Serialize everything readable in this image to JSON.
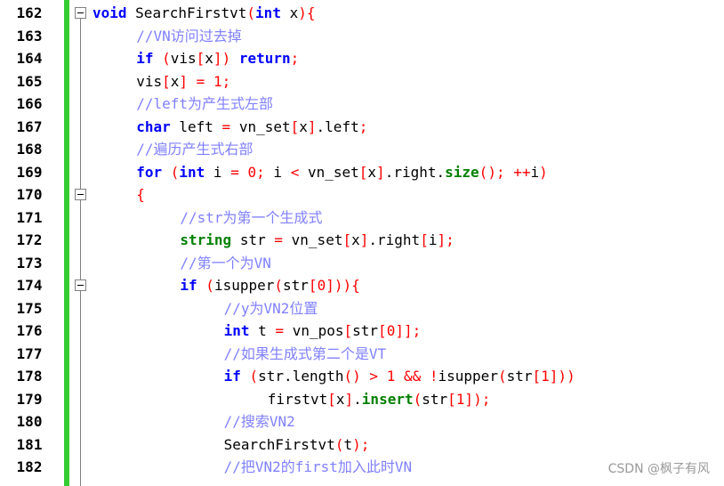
{
  "editor": {
    "lines": [
      {
        "num": "162",
        "text": "void SearchFirstvt(int x){"
      },
      {
        "num": "163",
        "text": "//VN访问过去掉"
      },
      {
        "num": "164",
        "text": "if (vis[x]) return;"
      },
      {
        "num": "165",
        "text": "vis[x] = 1;"
      },
      {
        "num": "166",
        "text": "//left为产生式左部"
      },
      {
        "num": "167",
        "text": "char left = vn_set[x].left;"
      },
      {
        "num": "168",
        "text": "//遍历产生式右部"
      },
      {
        "num": "169",
        "text": "for (int i = 0; i < vn_set[x].right.size(); ++i)"
      },
      {
        "num": "170",
        "text": "{"
      },
      {
        "num": "171",
        "text": "//str为第一个生成式"
      },
      {
        "num": "172",
        "text": "string str = vn_set[x].right[i];"
      },
      {
        "num": "173",
        "text": "//第一个为VN"
      },
      {
        "num": "174",
        "text": "if (isupper(str[0])){"
      },
      {
        "num": "175",
        "text": "//y为VN2位置"
      },
      {
        "num": "176",
        "text": "int t = vn_pos[str[0]];"
      },
      {
        "num": "177",
        "text": "//如果生成式第二个是VT"
      },
      {
        "num": "178",
        "text": "if (str.length() > 1 && !isupper(str[1]))"
      },
      {
        "num": "179",
        "text": "firstvt[x].insert(str[1]);"
      },
      {
        "num": "180",
        "text": "//搜索VN2"
      },
      {
        "num": "181",
        "text": "SearchFirstvt(t);"
      },
      {
        "num": "182",
        "text": "//把VN2的first加入此时VN"
      }
    ]
  },
  "watermark": "CSDN @枫子有风",
  "colors": {
    "keyword": "#0000ff",
    "type_string": "#008000",
    "comment": "#8080ff",
    "number": "#ff0000",
    "changebar": "#33cc33"
  }
}
